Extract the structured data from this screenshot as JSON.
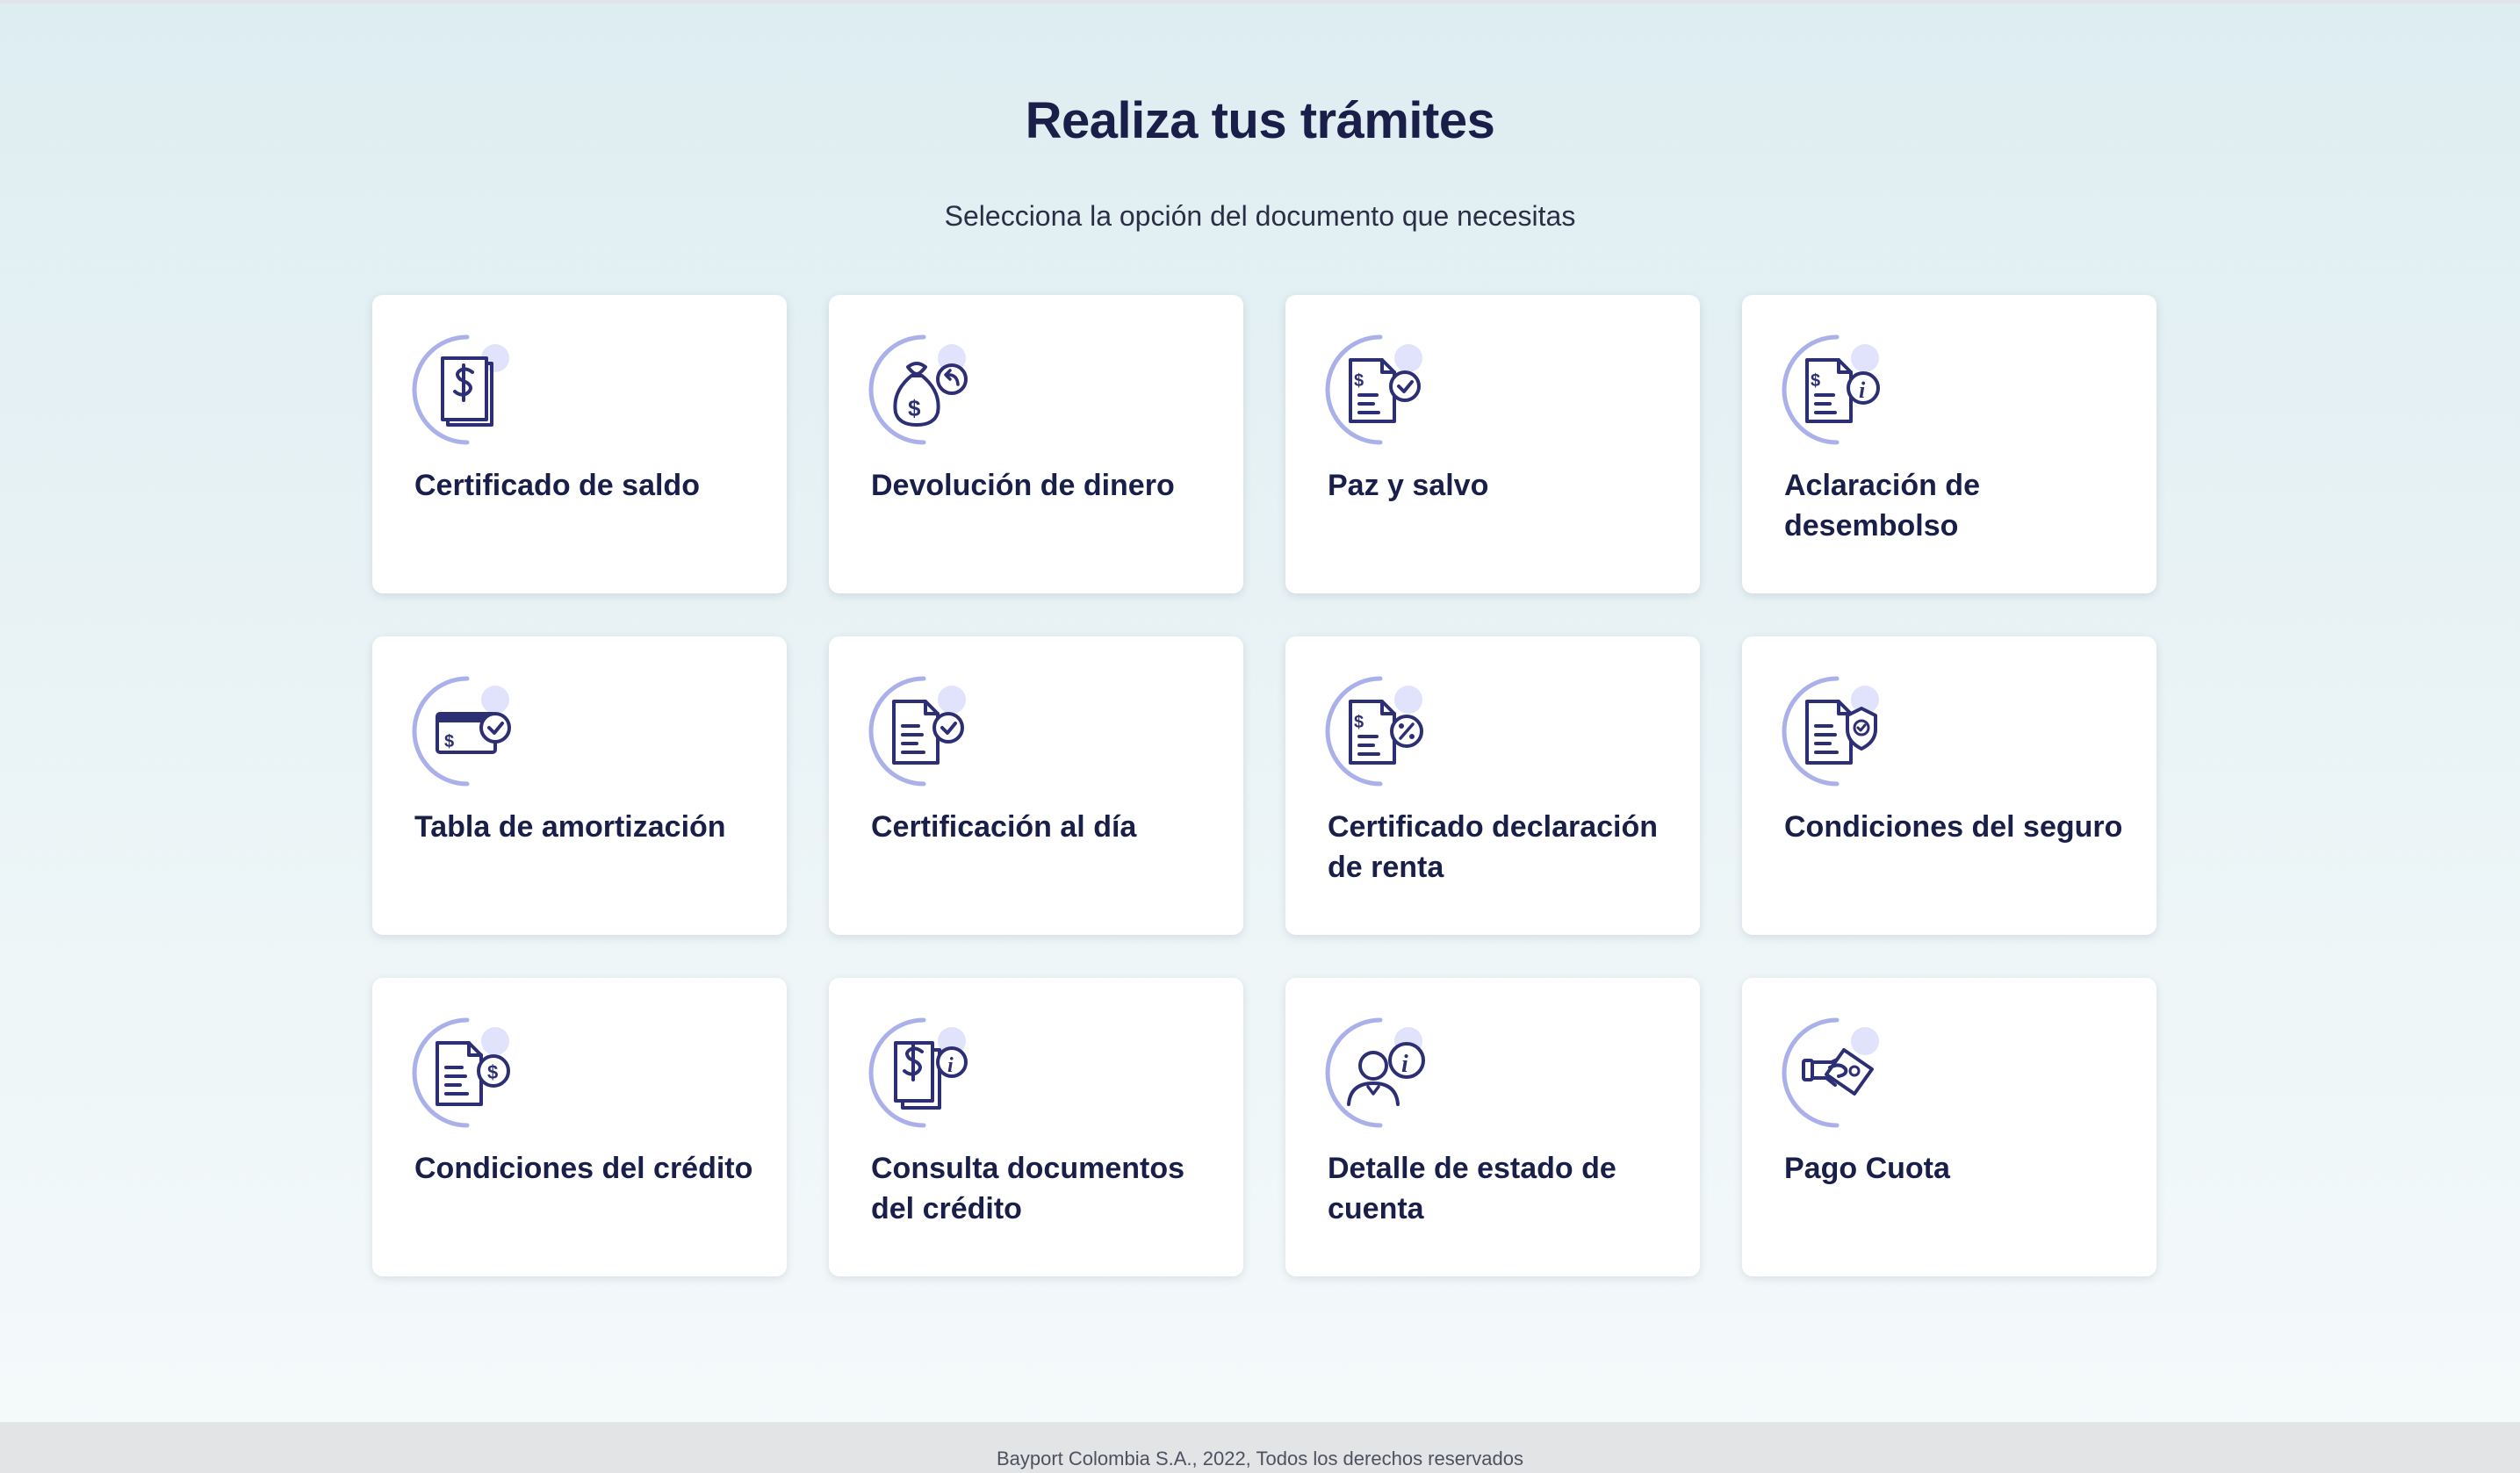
{
  "header": {
    "title": "Realiza tus trámites",
    "subtitle": "Selecciona la opción del documento que necesitas"
  },
  "options": [
    {
      "label": "Certificado de saldo",
      "icon": "dollar-document-icon"
    },
    {
      "label": "Devolución de dinero",
      "icon": "money-bag-return-icon"
    },
    {
      "label": "Paz y salvo",
      "icon": "document-check-icon"
    },
    {
      "label": "Aclaración de desembolso",
      "icon": "document-info-icon"
    },
    {
      "label": "Tabla de amortización",
      "icon": "payment-card-check-icon"
    },
    {
      "label": "Certificación al día",
      "icon": "document-check-icon"
    },
    {
      "label": "Certificado declaración de renta",
      "icon": "document-percent-icon"
    },
    {
      "label": "Condiciones del seguro",
      "icon": "document-shield-icon"
    },
    {
      "label": "Condiciones del crédito",
      "icon": "document-dollar-icon"
    },
    {
      "label": "Consulta documentos del crédito",
      "icon": "documents-info-icon"
    },
    {
      "label": "Detalle de estado de cuenta",
      "icon": "user-info-icon"
    },
    {
      "label": "Pago Cuota",
      "icon": "hand-payment-icon"
    }
  ],
  "footer": {
    "text": "Bayport Colombia S.A., 2022, Todos los derechos reservados"
  },
  "colors": {
    "navy": "#2d2f75",
    "accent_ring": "#aab0ea",
    "accent_dot": "#e0e3fb",
    "heading": "#1a1f4a"
  }
}
